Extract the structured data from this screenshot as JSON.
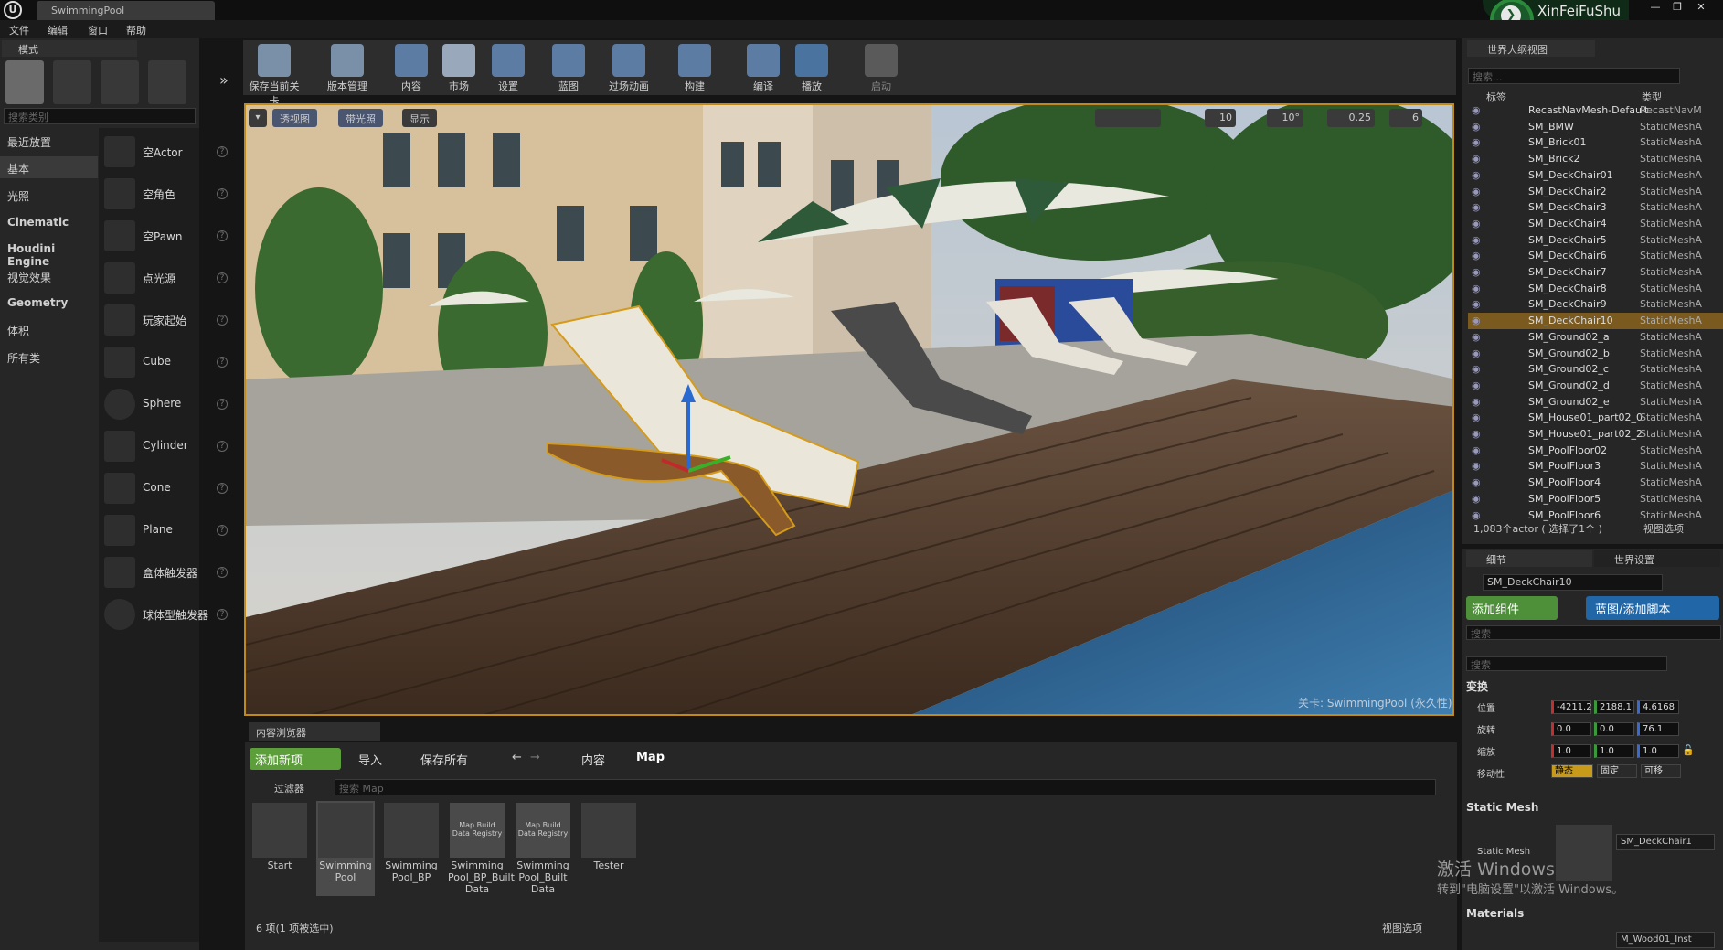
{
  "titlebar": {
    "tab": "SwimmingPool",
    "brand": "XinFeiFuShu"
  },
  "menu": [
    "文件",
    "编辑",
    "窗口",
    "帮助"
  ],
  "modes": {
    "tab": "模式",
    "search_placeholder": "搜索类别",
    "categories": [
      "最近放置",
      "基本",
      "光照",
      "Cinematic",
      "Houdini Engine",
      "视觉效果",
      "Geometry",
      "体积",
      "所有类"
    ],
    "items": [
      "空Actor",
      "空角色",
      "空Pawn",
      "点光源",
      "玩家起始",
      "Cube",
      "Sphere",
      "Cylinder",
      "Cone",
      "Plane",
      "盒体触发器",
      "球体型触发器"
    ]
  },
  "toolbar": [
    "保存当前关卡",
    "版本管理",
    "内容",
    "市场",
    "设置",
    "蓝图",
    "过场动画",
    "构建",
    "编译",
    "播放",
    "启动"
  ],
  "viewport": {
    "perspective": "透视图",
    "lit": "带光照",
    "show": "显示",
    "grid_snap": "10",
    "rot_snap": "10°",
    "scale_snap": "0.25",
    "cam_speed": "6",
    "level_label": "关卡:  SwimmingPool (永久性)"
  },
  "content_browser": {
    "tab": "内容浏览器",
    "add": "添加新项",
    "import": "导入",
    "save_all": "保存所有",
    "path_root": "内容",
    "path_leaf": "Map",
    "filters": "过滤器",
    "search_placeholder": "搜索 Map",
    "assets": [
      {
        "label": "Start",
        "registry": ""
      },
      {
        "label": "Swimming Pool",
        "registry": ""
      },
      {
        "label": "Swimming Pool_BP",
        "registry": ""
      },
      {
        "label": "Swimming Pool_BP_Built Data",
        "registry": "Map Build Data Registry"
      },
      {
        "label": "Swimming Pool_Built Data",
        "registry": "Map Build Data Registry"
      },
      {
        "label": "Tester",
        "registry": ""
      }
    ],
    "count": "6 项(1 项被选中)",
    "view_options": "视图选项"
  },
  "outliner": {
    "tab": "世界大纲视图",
    "search_placeholder": "搜索...",
    "col_label": "标签",
    "col_type": "类型",
    "rows": [
      {
        "name": "RecastNavMesh-Default",
        "type": "RecastNavM"
      },
      {
        "name": "SM_BMW",
        "type": "StaticMeshA"
      },
      {
        "name": "SM_Brick01",
        "type": "StaticMeshA"
      },
      {
        "name": "SM_Brick2",
        "type": "StaticMeshA"
      },
      {
        "name": "SM_DeckChair01",
        "type": "StaticMeshA"
      },
      {
        "name": "SM_DeckChair2",
        "type": "StaticMeshA"
      },
      {
        "name": "SM_DeckChair3",
        "type": "StaticMeshA"
      },
      {
        "name": "SM_DeckChair4",
        "type": "StaticMeshA"
      },
      {
        "name": "SM_DeckChair5",
        "type": "StaticMeshA"
      },
      {
        "name": "SM_DeckChair6",
        "type": "StaticMeshA"
      },
      {
        "name": "SM_DeckChair7",
        "type": "StaticMeshA"
      },
      {
        "name": "SM_DeckChair8",
        "type": "StaticMeshA"
      },
      {
        "name": "SM_DeckChair9",
        "type": "StaticMeshA"
      },
      {
        "name": "SM_DeckChair10",
        "type": "StaticMeshA"
      },
      {
        "name": "SM_Ground02_a",
        "type": "StaticMeshA"
      },
      {
        "name": "SM_Ground02_b",
        "type": "StaticMeshA"
      },
      {
        "name": "SM_Ground02_c",
        "type": "StaticMeshA"
      },
      {
        "name": "SM_Ground02_d",
        "type": "StaticMeshA"
      },
      {
        "name": "SM_Ground02_e",
        "type": "StaticMeshA"
      },
      {
        "name": "SM_House01_part02_0",
        "type": "StaticMeshA"
      },
      {
        "name": "SM_House01_part02_2",
        "type": "StaticMeshA"
      },
      {
        "name": "SM_PoolFloor02",
        "type": "StaticMeshA"
      },
      {
        "name": "SM_PoolFloor3",
        "type": "StaticMeshA"
      },
      {
        "name": "SM_PoolFloor4",
        "type": "StaticMeshA"
      },
      {
        "name": "SM_PoolFloor5",
        "type": "StaticMeshA"
      },
      {
        "name": "SM_PoolFloor6",
        "type": "StaticMeshA"
      }
    ],
    "selected_index": 13,
    "count": "1,083个actor ( 选择了1个 )",
    "view_options": "视图选项"
  },
  "details": {
    "tab": "细节",
    "tab2": "世界设置",
    "name": "SM_DeckChair10",
    "add_component": "添加组件",
    "blueprint": "蓝图/添加脚本",
    "search1": "搜索",
    "search2": "搜索",
    "transform": "变换",
    "location_label": "位置",
    "rotation_label": "旋转",
    "scale_label": "缩放",
    "mobility_label": "移动性",
    "location": [
      "-4211.2",
      "2188.1",
      "4.6168"
    ],
    "rotation": [
      "0.0",
      "0.0",
      "76.1"
    ],
    "scale": [
      "1.0",
      "1.0",
      "1.0"
    ],
    "mobility": [
      "静态",
      "固定",
      "可移"
    ],
    "static_mesh_section": "Static Mesh",
    "static_mesh_label": "Static Mesh",
    "static_mesh_value": "SM_DeckChair1",
    "materials_section": "Materials",
    "material_value": "M_Wood01_Inst"
  },
  "activation": {
    "line1": "激活 Windows",
    "line2": "转到\"电脑设置\"以激活 Windows。"
  }
}
